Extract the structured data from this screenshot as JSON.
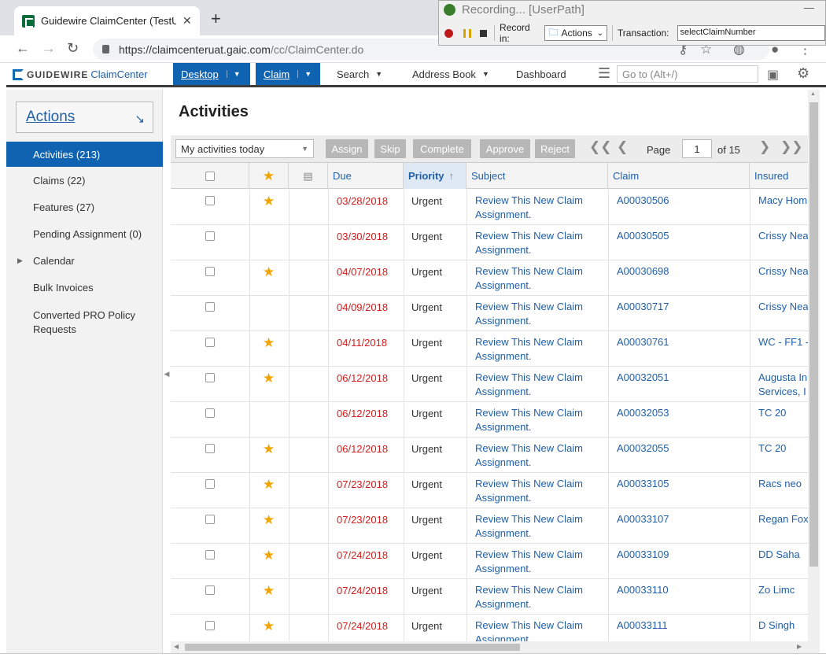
{
  "browser": {
    "tab_title": "Guidewire ClaimCenter (TestUser",
    "url_main": "https://claimcenteruat.gaic.com",
    "url_path": "/cc/ClaimCenter.do"
  },
  "recorder": {
    "title": "Recording... [UserPath]",
    "record_in_label": "Record in:",
    "record_in_value": "Actions",
    "transaction_label": "Transaction:",
    "transaction_value": "selectClaimNumber"
  },
  "app": {
    "logo_text": "GUIDEWIRE",
    "logo_product": "ClaimCenter",
    "menu": {
      "desktop": "Desktop",
      "claim": "Claim",
      "search": "Search",
      "address_book": "Address Book",
      "dashboard": "Dashboard"
    },
    "goto_placeholder": "Go to (Alt+/)"
  },
  "sidebar": {
    "actions_label": "Actions",
    "items": [
      {
        "label": "Activities (213)"
      },
      {
        "label": "Claims (22)"
      },
      {
        "label": "Features (27)"
      },
      {
        "label": "Pending Assignment (0)"
      },
      {
        "label": "Calendar"
      },
      {
        "label": "Bulk Invoices"
      },
      {
        "label": "Converted PRO Policy Requests"
      }
    ]
  },
  "main": {
    "title": "Activities",
    "filter_value": "My activities today",
    "buttons": {
      "assign": "Assign",
      "skip": "Skip",
      "complete": "Complete",
      "approve": "Approve",
      "reject": "Reject"
    },
    "pager": {
      "page_label": "Page",
      "page_value": "1",
      "of_label": "of 15"
    },
    "columns": {
      "due": "Due",
      "priority": "Priority",
      "subject": "Subject",
      "claim": "Claim",
      "insured": "Insured"
    },
    "rows": [
      {
        "starred": true,
        "due": "03/28/2018",
        "priority": "Urgent",
        "subject": "Review This New Claim Assignment.",
        "claim": "A00030506",
        "insured": "Macy Hom"
      },
      {
        "starred": false,
        "due": "03/30/2018",
        "priority": "Urgent",
        "subject": "Review This New Claim Assignment.",
        "claim": "A00030505",
        "insured": "Crissy Nea"
      },
      {
        "starred": true,
        "due": "04/07/2018",
        "priority": "Urgent",
        "subject": "Review This New Claim Assignment.",
        "claim": "A00030698",
        "insured": "Crissy Nea"
      },
      {
        "starred": false,
        "due": "04/09/2018",
        "priority": "Urgent",
        "subject": "Review This New Claim Assignment.",
        "claim": "A00030717",
        "insured": "Crissy Nea"
      },
      {
        "starred": true,
        "due": "04/11/2018",
        "priority": "Urgent",
        "subject": "Review This New Claim Assignment.",
        "claim": "A00030761",
        "insured": "WC - FF1 -"
      },
      {
        "starred": true,
        "due": "06/12/2018",
        "priority": "Urgent",
        "subject": "Review This New Claim Assignment.",
        "claim": "A00032051",
        "insured": "Augusta In Services, I"
      },
      {
        "starred": false,
        "due": "06/12/2018",
        "priority": "Urgent",
        "subject": "Review This New Claim Assignment.",
        "claim": "A00032053",
        "insured": "TC 20"
      },
      {
        "starred": true,
        "due": "06/12/2018",
        "priority": "Urgent",
        "subject": "Review This New Claim Assignment.",
        "claim": "A00032055",
        "insured": "TC 20"
      },
      {
        "starred": true,
        "due": "07/23/2018",
        "priority": "Urgent",
        "subject": "Review This New Claim Assignment.",
        "claim": "A00033105",
        "insured": "Racs neo"
      },
      {
        "starred": true,
        "due": "07/23/2018",
        "priority": "Urgent",
        "subject": "Review This New Claim Assignment.",
        "claim": "A00033107",
        "insured": "Regan Fox"
      },
      {
        "starred": true,
        "due": "07/24/2018",
        "priority": "Urgent",
        "subject": "Review This New Claim Assignment.",
        "claim": "A00033109",
        "insured": "DD Saha"
      },
      {
        "starred": true,
        "due": "07/24/2018",
        "priority": "Urgent",
        "subject": "Review This New Claim Assignment.",
        "claim": "A00033110",
        "insured": "Zo Limc"
      },
      {
        "starred": true,
        "due": "07/24/2018",
        "priority": "Urgent",
        "subject": "Review This New Claim Assignment.",
        "claim": "A00033111",
        "insured": "D Singh"
      }
    ]
  },
  "colors": {
    "accent": "#0f63b0",
    "link": "#1f5fa8",
    "due_red": "#d21b1b",
    "star": "#f0a400"
  }
}
